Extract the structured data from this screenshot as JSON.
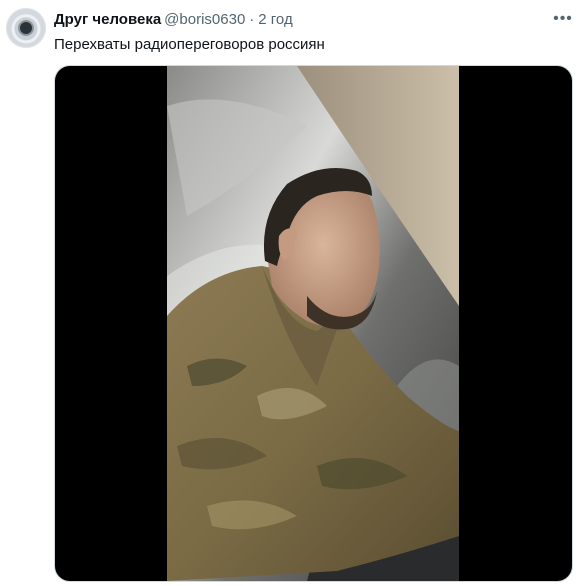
{
  "tweet": {
    "author_name": "Друг человека",
    "author_handle": "@boris0630",
    "separator": "·",
    "time": "2 год",
    "more_icon": "more-horizontal-icon",
    "text": "Перехваты радиопереговоров россиян"
  },
  "colors": {
    "name": "#0f1419",
    "secondary": "#536471",
    "media_background": "#000000"
  }
}
